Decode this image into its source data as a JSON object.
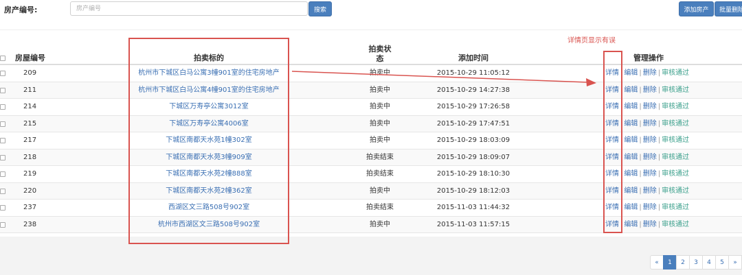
{
  "search": {
    "label": "房产编号:",
    "placeholder": "房产编号",
    "search_button": "搜索"
  },
  "toolbar": {
    "add_button": "添加房产",
    "batch_delete_button": "批量删除"
  },
  "table": {
    "headers": {
      "id": "房屋编号",
      "title": "拍卖标的",
      "status_line1": "拍卖状",
      "status_line2": "态",
      "time": "添加时间",
      "ops": "管理操作"
    },
    "op_labels": {
      "detail": "详情",
      "edit": "编辑",
      "delete": "删除",
      "approve": "审核通过",
      "separator": "|"
    },
    "rows": [
      {
        "id": "209",
        "title": "杭州市下城区白马公寓3幢901室的住宅房地产",
        "status": "拍卖中",
        "time": "2015-10-29 11:05:12"
      },
      {
        "id": "211",
        "title": "杭州市下城区白马公寓4幢901室的住宅房地产",
        "status": "拍卖中",
        "time": "2015-10-29 14:27:38"
      },
      {
        "id": "214",
        "title": "下城区万寿亭公寓3012室",
        "status": "拍卖中",
        "time": "2015-10-29 17:26:58"
      },
      {
        "id": "215",
        "title": "下城区万寿亭公寓4006室",
        "status": "拍卖中",
        "time": "2015-10-29 17:47:51"
      },
      {
        "id": "217",
        "title": "下城区南都天水苑1幢302室",
        "status": "拍卖中",
        "time": "2015-10-29 18:03:09"
      },
      {
        "id": "218",
        "title": "下城区南都天水苑3幢909室",
        "status": "拍卖结束",
        "time": "2015-10-29 18:09:07"
      },
      {
        "id": "219",
        "title": "下城区南都天水苑2幢888室",
        "status": "拍卖结束",
        "time": "2015-10-29 18:10:30"
      },
      {
        "id": "220",
        "title": "下城区南都天水苑2幢362室",
        "status": "拍卖中",
        "time": "2015-10-29 18:12:03"
      },
      {
        "id": "237",
        "title": "西湖区文三路508号902室",
        "status": "拍卖结束",
        "time": "2015-11-03 11:44:32"
      },
      {
        "id": "238",
        "title": "杭州市西湖区文三路508号902室",
        "status": "拍卖中",
        "time": "2015-11-03 11:57:15"
      }
    ]
  },
  "pagination": {
    "prev": "«",
    "pages": [
      "1",
      "2",
      "3",
      "4",
      "5"
    ],
    "active": "1",
    "next": "»"
  },
  "annotation": {
    "note": "详情页显示有误",
    "color": "#d9534f"
  },
  "colors": {
    "primary": "#4a7fbd",
    "link": "#3a6fb3",
    "approve": "#3ba08c"
  }
}
